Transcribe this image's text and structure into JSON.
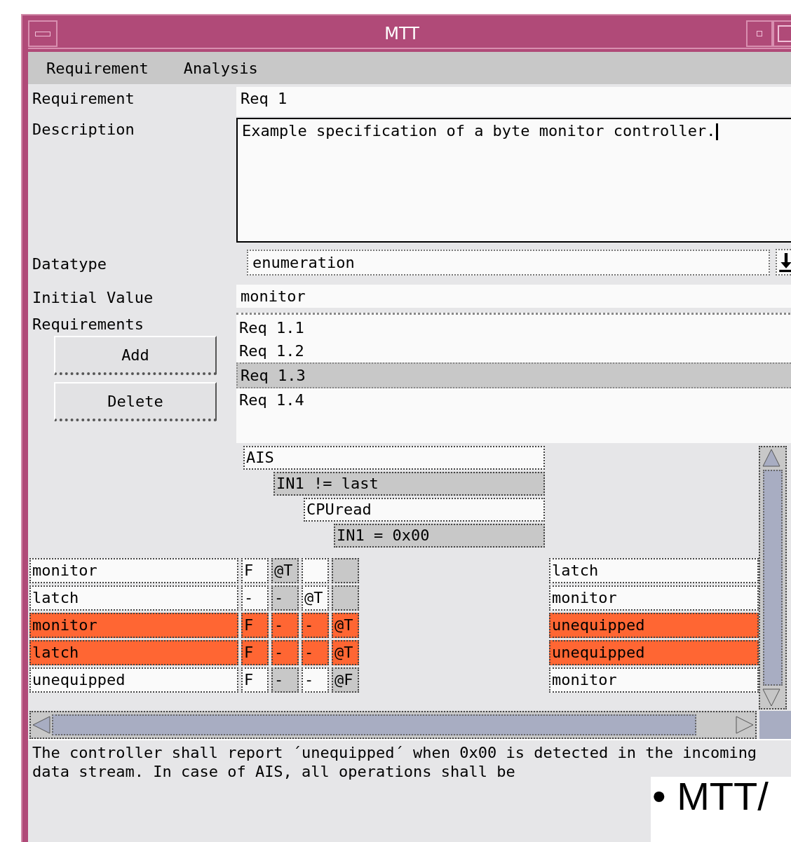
{
  "window": {
    "title": "MTT"
  },
  "menu": [
    "Requirement",
    "Analysis"
  ],
  "form": {
    "requirement_label": "Requirement",
    "requirement_value": "Req 1",
    "description_label": "Description",
    "description_value": "Example specification of a byte monitor controller.",
    "datatype_label": "Datatype",
    "datatype_value": "enumeration",
    "initial_label": "Initial Value",
    "initial_value": "monitor",
    "requirements_label": "Requirements",
    "requirements": [
      {
        "label": "Req 1.1",
        "selected": false
      },
      {
        "label": "Req 1.2",
        "selected": false
      },
      {
        "label": "Req 1.3",
        "selected": true
      },
      {
        "label": "Req 1.4",
        "selected": false
      }
    ],
    "buttons": [
      "Add",
      "Delete"
    ]
  },
  "conditions": [
    {
      "text": "AIS",
      "shaded": false
    },
    {
      "text": "IN1 != last",
      "shaded": true
    },
    {
      "text": "CPUread",
      "shaded": false
    },
    {
      "text": "IN1 = 0x00",
      "shaded": true
    }
  ],
  "rows": [
    {
      "state": "monitor",
      "cells": [
        {
          "text": "F"
        },
        {
          "text": "@T"
        },
        {},
        {}
      ],
      "result": "latch",
      "highlighted": false
    },
    {
      "state": "latch",
      "cells": [
        {
          "text": "-"
        },
        {
          "text": "-"
        },
        {
          "text": "@T"
        },
        {}
      ],
      "result": "monitor",
      "highlighted": false
    },
    {
      "state": "monitor",
      "cells": [
        {
          "text": "F"
        },
        {
          "text": "-"
        },
        {
          "text": "-"
        },
        {
          "text": "@T"
        }
      ],
      "result": "unequipped",
      "highlighted": true
    },
    {
      "state": "latch",
      "cells": [
        {
          "text": "F"
        },
        {
          "text": "-"
        },
        {
          "text": "-"
        },
        {
          "text": "@T"
        }
      ],
      "result": "unequipped",
      "highlighted": true
    },
    {
      "state": "unequipped",
      "cells": [
        {
          "text": "F"
        },
        {
          "text": "-"
        },
        {
          "text": "-"
        },
        {
          "text": "@F"
        }
      ],
      "result": "monitor",
      "highlighted": false
    }
  ],
  "comment": "The controller shall report ´unequipped´ when 0x00 is detected in the incoming data stream. In case of AIS, all operations shall be",
  "overlay": {
    "text": "• MTT/"
  }
}
